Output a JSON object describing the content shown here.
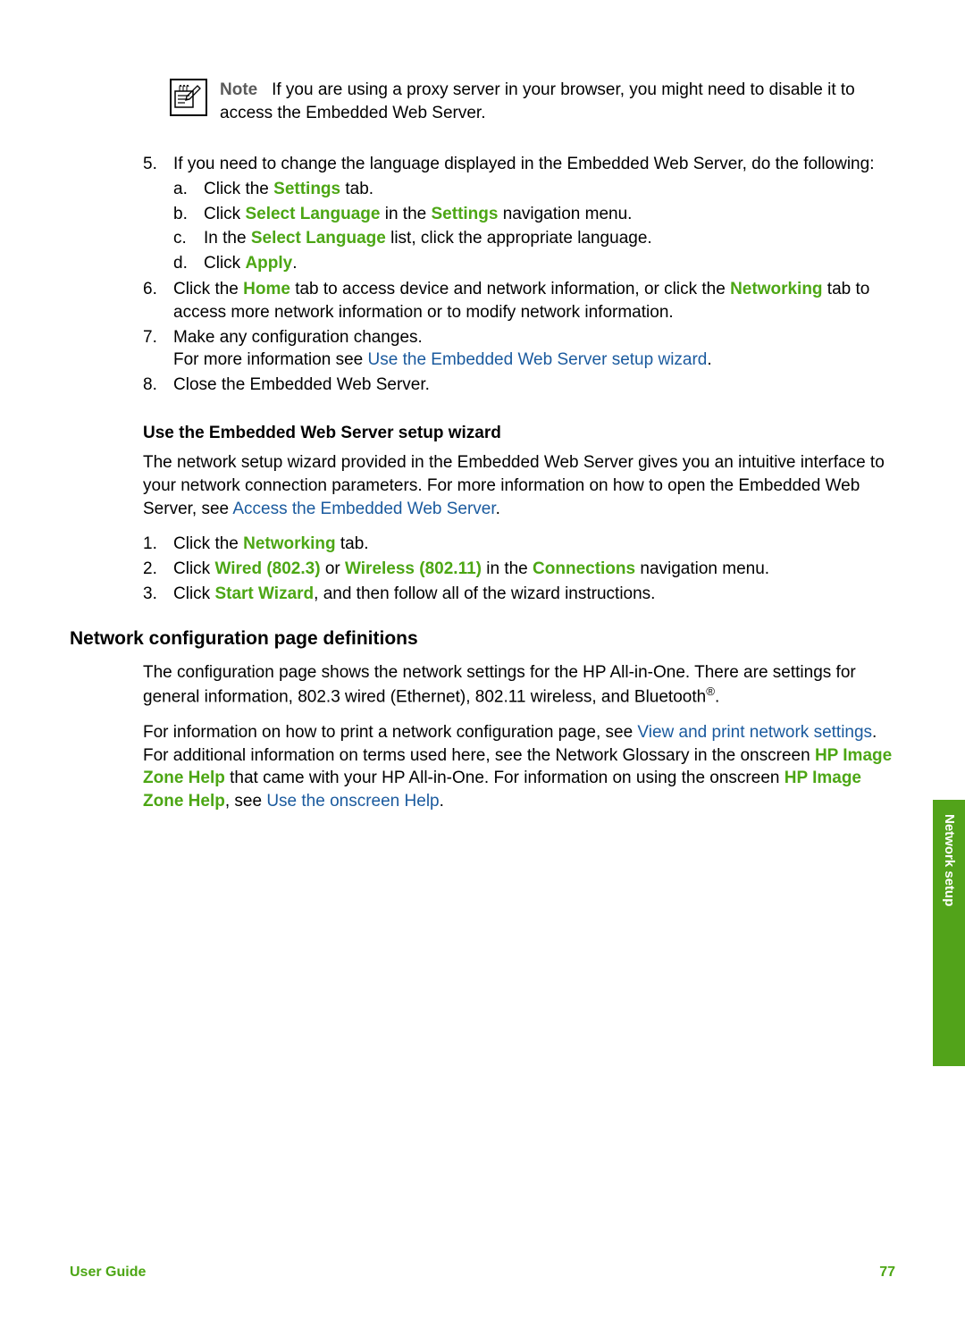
{
  "note": {
    "label": "Note",
    "text": "If you are using a proxy server in your browser, you might need to disable it to access the Embedded Web Server."
  },
  "steps": {
    "s5": {
      "num": "5.",
      "intro": "If you need to change the language displayed in the Embedded Web Server, do the following:",
      "a": {
        "marker": "a.",
        "pre": "Click the ",
        "b1": "Settings",
        "post": " tab."
      },
      "b": {
        "marker": "b.",
        "pre": "Click ",
        "b1": "Select Language",
        "mid": " in the ",
        "b2": "Settings",
        "post": " navigation menu."
      },
      "c": {
        "marker": "c.",
        "pre": "In the ",
        "b1": "Select Language",
        "post": " list, click the appropriate language."
      },
      "d": {
        "marker": "d.",
        "pre": "Click ",
        "b1": "Apply",
        "post": "."
      }
    },
    "s6": {
      "num": "6.",
      "pre": "Click the ",
      "b1": "Home",
      "mid1": " tab to access device and network information, or click the ",
      "b2": "Networking",
      "post": " tab to access more network information or to modify network information."
    },
    "s7": {
      "num": "7.",
      "line1": "Make any configuration changes.",
      "line2_pre": "For more information see ",
      "line2_link": "Use the Embedded Web Server setup wizard",
      "line2_post": "."
    },
    "s8": {
      "num": "8.",
      "text": "Close the Embedded Web Server."
    }
  },
  "subheading1": "Use the Embedded Web Server setup wizard",
  "para1": {
    "pre": "The network setup wizard provided in the Embedded Web Server gives you an intuitive interface to your network connection parameters. For more information on how to open the Embedded Web Server, see ",
    "link": "Access the Embedded Web Server",
    "post": "."
  },
  "steps2": {
    "s1": {
      "num": "1.",
      "pre": "Click the ",
      "b1": "Networking",
      "post": " tab."
    },
    "s2": {
      "num": "2.",
      "pre": "Click ",
      "b1": "Wired (802.3)",
      "mid1": " or ",
      "b2": "Wireless (802.11)",
      "mid2": " in the ",
      "b3": "Connections",
      "post": " navigation menu."
    },
    "s3": {
      "num": "3.",
      "pre": "Click ",
      "b1": "Start Wizard",
      "post": ", and then follow all of the wizard instructions."
    }
  },
  "section_heading": "Network configuration page definitions",
  "para2": {
    "text": "The configuration page shows the network settings for the HP All-in-One. There are settings for general information, 802.3 wired (Ethernet), 802.11 wireless, and Bluetooth",
    "sup": "®",
    "post": "."
  },
  "para3": {
    "t1": "For information on how to print a network configuration page, see ",
    "link1": "View and print network settings",
    "t2": ". For additional information on terms used here, see the Network Glossary in the onscreen ",
    "b1": "HP Image Zone Help",
    "t3": " that came with your HP All-in-One. For information on using the onscreen ",
    "b2": "HP Image Zone Help",
    "t4": ", see ",
    "link2": "Use the onscreen Help",
    "t5": "."
  },
  "footer": {
    "left": "User Guide",
    "right": "77"
  },
  "side_tab": "Network setup"
}
